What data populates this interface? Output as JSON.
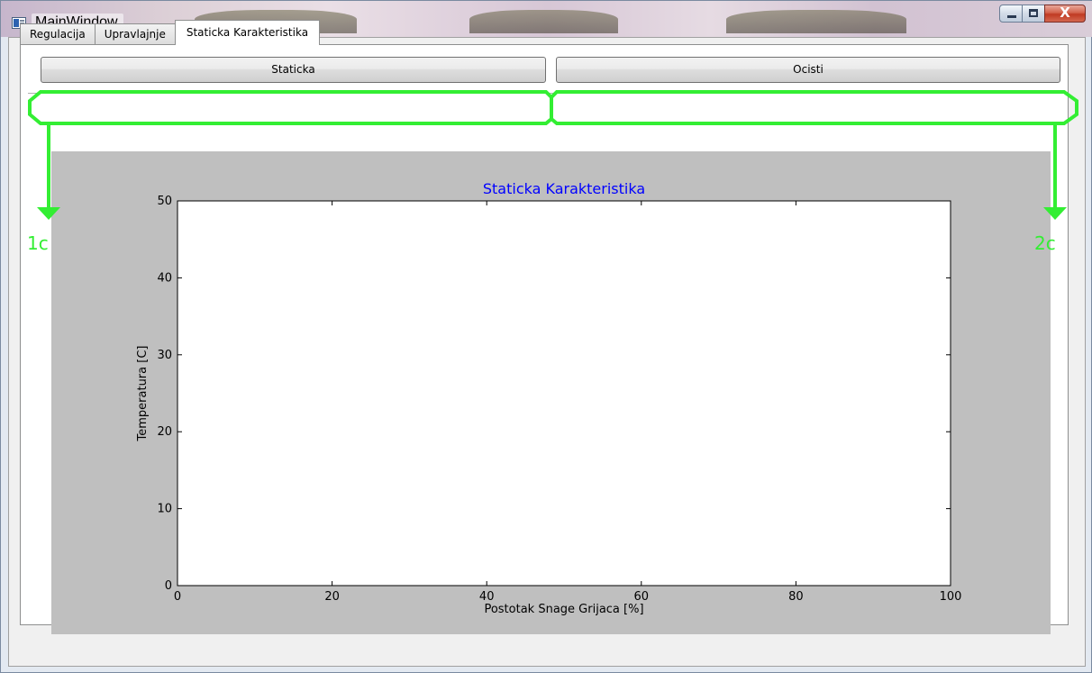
{
  "window": {
    "title": "MainWindow",
    "close_glyph": "X"
  },
  "tabs": [
    {
      "label": "Regulacija",
      "active": false
    },
    {
      "label": "Upravlajnje",
      "active": false
    },
    {
      "label": "Staticka Karakteristika",
      "active": true
    }
  ],
  "toolbar": {
    "staticka_label": "Staticka",
    "ocisti_label": "Ocisti"
  },
  "annotations": {
    "left_label": "1c",
    "right_label": "2c",
    "color": "#33ee33"
  },
  "chart_data": {
    "type": "scatter",
    "title": "Staticka Karakteristika",
    "xlabel": "Postotak Snage Grijaca [%]",
    "ylabel": "Temperatura [C]",
    "xlim": [
      0,
      100
    ],
    "ylim": [
      0,
      50
    ],
    "xticks": [
      0,
      20,
      40,
      60,
      80,
      100
    ],
    "yticks": [
      0,
      10,
      20,
      30,
      40,
      50
    ],
    "grid": false,
    "series": [],
    "title_color": "#0000ff"
  }
}
